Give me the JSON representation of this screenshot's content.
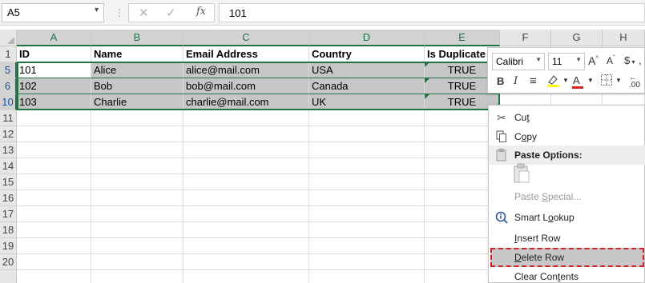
{
  "formula_bar": {
    "name_box": "A5",
    "fx_label": "fx",
    "value": "101"
  },
  "columns": [
    "A",
    "B",
    "C",
    "D",
    "E",
    "F",
    "G",
    "H"
  ],
  "rows": [
    "1",
    "5",
    "6",
    "10",
    "11",
    "12",
    "13",
    "14",
    "15",
    "16",
    "17",
    "18",
    "19",
    "20"
  ],
  "table": {
    "headers": [
      "ID",
      "Name",
      "Email Address",
      "Country",
      "Is Duplicate"
    ],
    "data": [
      [
        "101",
        "Alice",
        "alice@mail.com",
        "USA",
        "TRUE"
      ],
      [
        "102",
        "Bob",
        "bob@mail.com",
        "Canada",
        "TRUE"
      ],
      [
        "103",
        "Charlie",
        "charlie@mail.com",
        "UK",
        "TRUE"
      ]
    ]
  },
  "mini_toolbar": {
    "font": "Calibri",
    "size": "11",
    "bold": "B",
    "italic": "I",
    "font_color": "A",
    "highlight_color": "#ffff00",
    "font_color_bar": "#e02020"
  },
  "context_menu": {
    "cut": "Cut",
    "copy": "Copy",
    "paste_options": "Paste Options:",
    "paste_special": "Paste Special...",
    "smart_lookup": "Smart Lookup",
    "insert_row": "Insert Row",
    "delete_row": "Delete Row",
    "clear_contents": "Clear Contents"
  },
  "colors": {
    "accent": "#217346",
    "selection": "#c6c6c6",
    "highlight_border": "#d0202a"
  }
}
